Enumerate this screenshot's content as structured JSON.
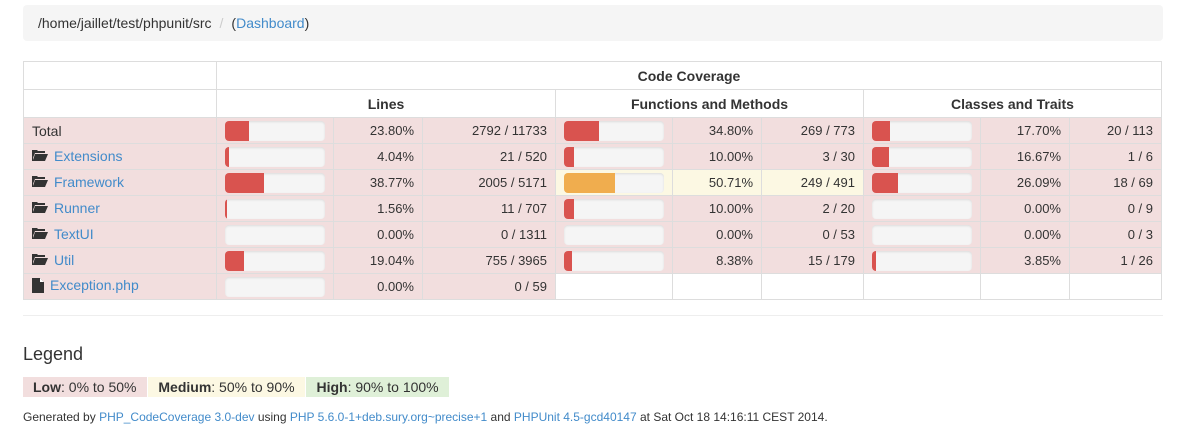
{
  "breadcrumb": {
    "path": "/home/jaillet/test/phpunit/src",
    "separator": "/",
    "open_paren": "(",
    "link": "Dashboard",
    "close_paren": ")"
  },
  "table": {
    "title": "Code Coverage",
    "groups": [
      "Lines",
      "Functions and Methods",
      "Classes and Traits"
    ],
    "rows": [
      {
        "name": "Total",
        "icon": "none",
        "lines": {
          "pct": 23.8,
          "pct_text": "23.80%",
          "count": "2792 / 11733",
          "level": "low"
        },
        "funcs": {
          "pct": 34.8,
          "pct_text": "34.80%",
          "count": "269 / 773",
          "level": "low"
        },
        "classes": {
          "pct": 17.7,
          "pct_text": "17.70%",
          "count": "20 / 113",
          "level": "low"
        }
      },
      {
        "name": "Extensions",
        "icon": "folder-icon",
        "lines": {
          "pct": 4.04,
          "pct_text": "4.04%",
          "count": "21 / 520",
          "level": "low"
        },
        "funcs": {
          "pct": 10.0,
          "pct_text": "10.00%",
          "count": "3 / 30",
          "level": "low"
        },
        "classes": {
          "pct": 16.67,
          "pct_text": "16.67%",
          "count": "1 / 6",
          "level": "low"
        }
      },
      {
        "name": "Framework",
        "icon": "folder-icon",
        "lines": {
          "pct": 38.77,
          "pct_text": "38.77%",
          "count": "2005 / 5171",
          "level": "low"
        },
        "funcs": {
          "pct": 50.71,
          "pct_text": "50.71%",
          "count": "249 / 491",
          "level": "med"
        },
        "classes": {
          "pct": 26.09,
          "pct_text": "26.09%",
          "count": "18 / 69",
          "level": "low"
        }
      },
      {
        "name": "Runner",
        "icon": "folder-icon",
        "lines": {
          "pct": 1.56,
          "pct_text": "1.56%",
          "count": "11 / 707",
          "level": "low"
        },
        "funcs": {
          "pct": 10.0,
          "pct_text": "10.00%",
          "count": "2 / 20",
          "level": "low"
        },
        "classes": {
          "pct": 0.0,
          "pct_text": "0.00%",
          "count": "0 / 9",
          "level": "low"
        }
      },
      {
        "name": "TextUI",
        "icon": "folder-icon",
        "lines": {
          "pct": 0.0,
          "pct_text": "0.00%",
          "count": "0 / 1311",
          "level": "low"
        },
        "funcs": {
          "pct": 0.0,
          "pct_text": "0.00%",
          "count": "0 / 53",
          "level": "low"
        },
        "classes": {
          "pct": 0.0,
          "pct_text": "0.00%",
          "count": "0 / 3",
          "level": "low"
        }
      },
      {
        "name": "Util",
        "icon": "folder-icon",
        "lines": {
          "pct": 19.04,
          "pct_text": "19.04%",
          "count": "755 / 3965",
          "level": "low"
        },
        "funcs": {
          "pct": 8.38,
          "pct_text": "8.38%",
          "count": "15 / 179",
          "level": "low"
        },
        "classes": {
          "pct": 3.85,
          "pct_text": "3.85%",
          "count": "1 / 26",
          "level": "low"
        }
      },
      {
        "name": "Exception.php",
        "icon": "file-icon",
        "lines": {
          "pct": 0.0,
          "pct_text": "0.00%",
          "count": "0 / 59",
          "level": "low"
        },
        "funcs": null,
        "classes": null
      }
    ]
  },
  "legend": {
    "title": "Legend",
    "low_label": "Low",
    "low_range": ": 0% to 50%",
    "medium_label": "Medium",
    "medium_range": ": 50% to 90%",
    "high_label": "High",
    "high_range": ": 90% to 100%"
  },
  "footer": {
    "t1": "Generated by ",
    "link1": "PHP_CodeCoverage 3.0-dev",
    "t2": " using ",
    "link2": "PHP 5.6.0-1+deb.sury.org~precise+1",
    "t3": " and ",
    "link3": "PHPUnit 4.5-gcd40147",
    "t4": " at Sat Oct 18 14:16:11 CEST 2014."
  },
  "colors": {
    "low_bg": "#f2dede",
    "medium_bg": "#fcf8e3",
    "high_bg": "#dff0d8",
    "bar_low": "#d9534f",
    "bar_medium": "#f0ad4e",
    "link": "#428bca"
  }
}
